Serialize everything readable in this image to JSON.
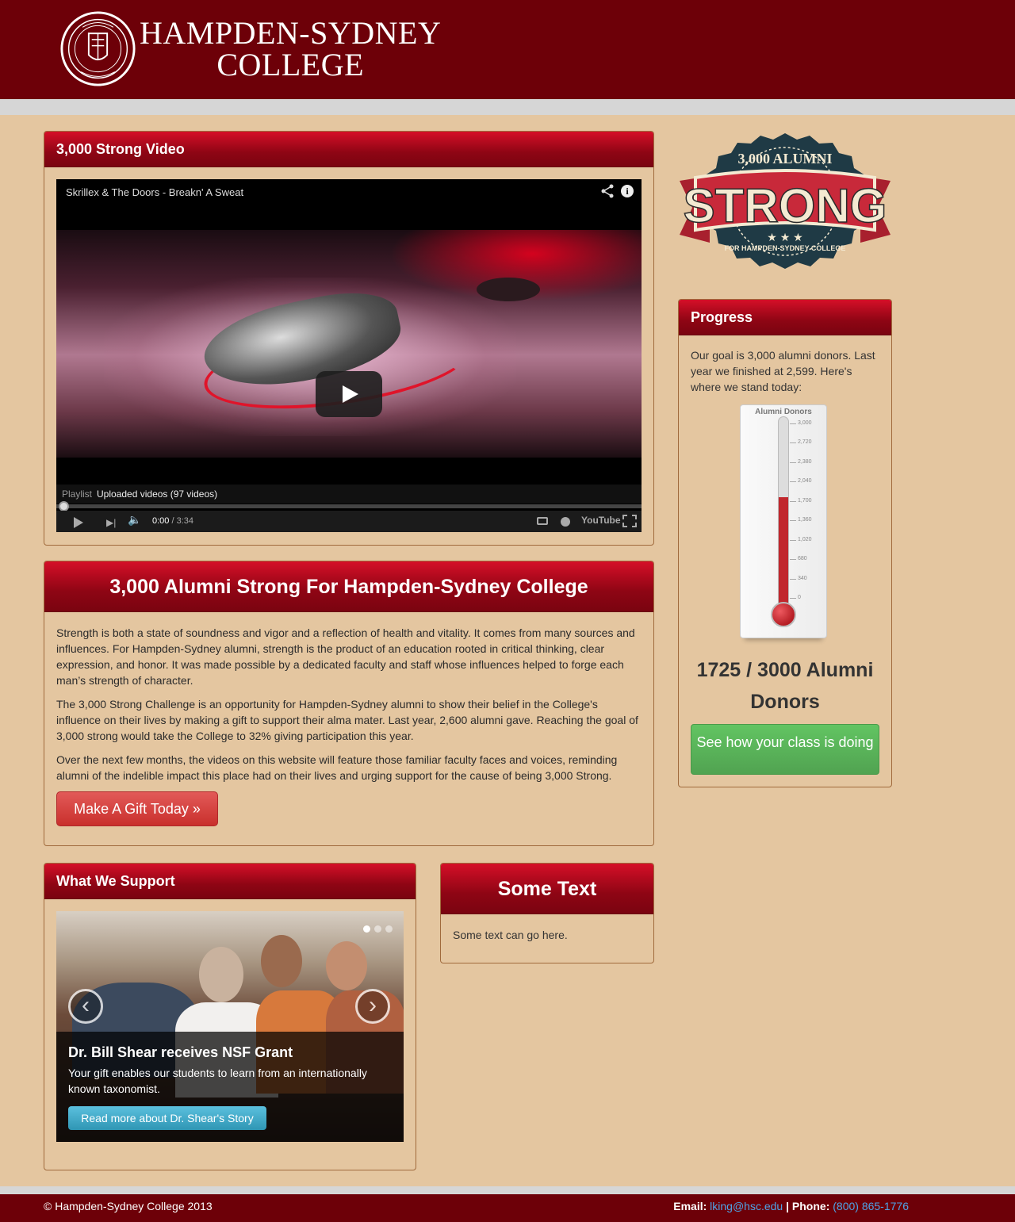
{
  "header": {
    "brand_line1": "HAMPDEN-SYDNEY",
    "brand_line2": "COLLEGE",
    "seal_text": "HAMPDEN-SYDNEY 1776"
  },
  "video_panel": {
    "title": "3,000 Strong Video",
    "video_title": "Skrillex & The Doors - Breakn' A Sweat",
    "playlist_label": "Playlist",
    "playlist_name": "Uploaded videos (97 videos)",
    "time_current": "0:00",
    "time_total": " / 3:34",
    "youtube_label": "YouTube",
    "progress": 0
  },
  "alumni_panel": {
    "title": "3,000 Alumni Strong For Hampden-Sydney College",
    "paragraphs": [
      "Strength is both a state of soundness and vigor and a reflection of health and vitality. It comes from many sources and influences. For Hampden-Sydney alumni, strength is the product of an education rooted in critical thinking, clear expression, and honor. It was made possible by a dedicated faculty and staff whose influences helped to forge each man’s strength of character.",
      "The 3,000 Strong Challenge is an opportunity for Hampden-Sydney alumni to show their belief in the College's influence on their lives by making a gift to support their alma mater. Last year, 2,600 alumni gave. Reaching the goal of 3,000 strong would take the College to 32% giving participation this year.",
      "Over the next few months, the videos on this website will feature those familiar faculty faces and voices, reminding alumni of the indelible impact this place had on their lives and urging support for the cause of being 3,000 Strong."
    ],
    "gift_button": "Make A Gift Today »"
  },
  "support_panel": {
    "title": "What We Support",
    "caption_title": "Dr. Bill Shear receives NSF Grant",
    "caption_text": "Your gift enables our students to learn from an internationally known taxonomist.",
    "read_more": "Read more about Dr. Shear's Story",
    "prev_icon": "‹",
    "next_icon": "›",
    "active_slide": 1,
    "slide_count": 3
  },
  "some_text_panel": {
    "title": "Some Text",
    "body": "Some text can go here."
  },
  "badge": {
    "top_text": "3,000 ALUMNI",
    "main_text": "STRONG",
    "bottom_text": "FOR HAMPDEN-SYDNEY COLLEGE"
  },
  "progress_panel": {
    "title": "Progress",
    "intro": "Our goal is 3,000 alumni donors. Last year we finished at 2,599. Here's where we stand today:",
    "thermometer_title": "Alumni Donors",
    "scale": [
      "3,000",
      "2,720",
      "2,380",
      "2,040",
      "1,700",
      "1,360",
      "1,020",
      "680",
      "340",
      "0"
    ],
    "current": 1725,
    "goal": 3000,
    "donor_count_text": "1725 / 3000 Alumni Donors",
    "class_button": "See how your class is doing"
  },
  "footer": {
    "copyright": "© Hampden-Sydney College 2013",
    "email_label": "Email: ",
    "email": "lking@hsc.edu",
    "phone_label": " | Phone: ",
    "phone": "(800) 865-1776"
  },
  "colors": {
    "maroon": "#6d0008",
    "tan_background": "#e4c6a0",
    "panel_header_red": "#c10d22",
    "gift_button_red": "#d9534f",
    "class_button_green": "#5bb75b",
    "read_more_blue": "#49afcd",
    "link_blue": "#4ea3e6"
  }
}
